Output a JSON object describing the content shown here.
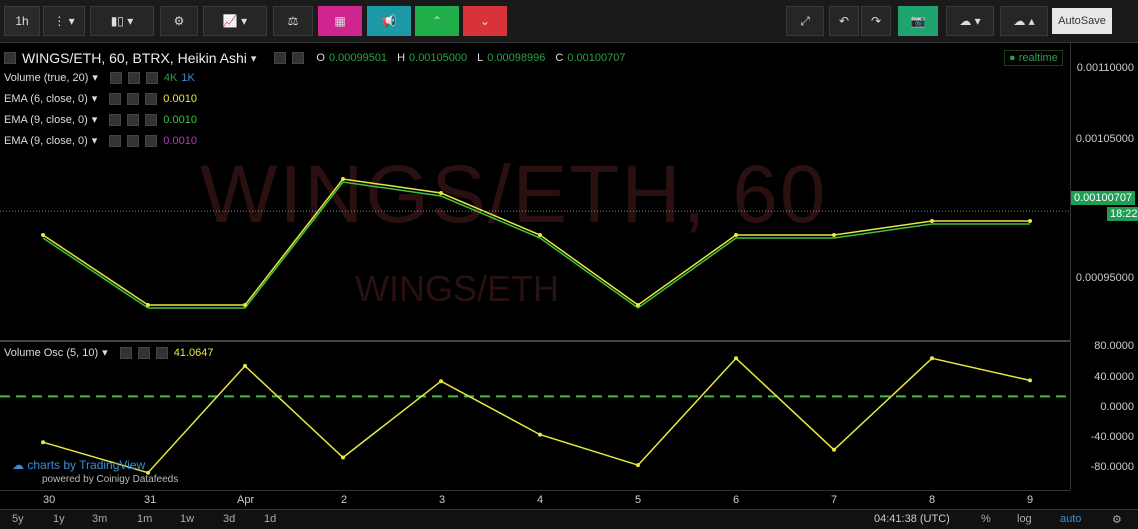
{
  "toolbar": {
    "interval": "1h",
    "autosave_label": "AutoSave",
    "colors": {
      "teal": "#1b9aa5",
      "green": "#1fae49",
      "red": "#d9333a"
    }
  },
  "symbol": {
    "title": "WINGS/ETH, 60, BTRX, Heikin Ashi",
    "watermark": "WINGS/ETH, 60",
    "watermark_sub": "WINGS/ETH",
    "o_label": "O",
    "o_value": "0.00099501",
    "h_label": "H",
    "h_value": "0.00105000",
    "l_label": "L",
    "l_value": "0.00098996",
    "c_label": "C",
    "c_value": "0.00100707",
    "realtime": "realtime"
  },
  "indicators": {
    "volume": {
      "label": "Volume (true, 20)",
      "v1": "4K",
      "v2": "1K"
    },
    "ema1": {
      "label": "EMA (6, close, 0)",
      "value": "0.0010",
      "color": "#e8e840"
    },
    "ema2": {
      "label": "EMA (9, close, 0)",
      "value": "0.0010",
      "color": "#3cc43c"
    },
    "ema3": {
      "label": "EMA (9, close, 0)",
      "value": "0.0010",
      "color": "#c030c0"
    },
    "vosc": {
      "label": "Volume Osc (5, 10)",
      "value": "41.0647"
    }
  },
  "price_scale": {
    "ticks": [
      "0.00110000",
      "0.00105000",
      "0.00095000"
    ],
    "current": "0.00100707",
    "countdown": "18:22"
  },
  "osc_scale": {
    "ticks": [
      "80.0000",
      "40.0000",
      "0.0000",
      "-40.0000",
      "-80.0000"
    ]
  },
  "xaxis": {
    "ticks": [
      "30",
      "31",
      "Apr",
      "2",
      "3",
      "4",
      "5",
      "6",
      "7",
      "8",
      "9"
    ]
  },
  "branding": {
    "line1": "charts by TradingView",
    "line2": "powered by Coinigy Datafeeds"
  },
  "bottom": {
    "ranges": [
      "5y",
      "1y",
      "3m",
      "1m",
      "1w",
      "3d",
      "1d"
    ],
    "time": "04:41:38 (UTC)",
    "pct": "%",
    "log": "log",
    "auto": "auto"
  },
  "chart_data": {
    "type": "line",
    "title": "WINGS/ETH, 60, BTRX, Heikin Ashi",
    "x": [
      "30",
      "31",
      "Apr",
      "2",
      "3",
      "4",
      "5",
      "6",
      "7",
      "8",
      "9"
    ],
    "series": [
      {
        "name": "EMA (6, close, 0)",
        "values": [
          0.00099,
          0.00094,
          0.00094,
          0.00103,
          0.00102,
          0.00099,
          0.00094,
          0.00099,
          0.00099,
          0.001,
          0.001
        ]
      }
    ],
    "ylim": [
      0.00092,
      0.00112
    ],
    "oscillator": {
      "name": "Volume Osc (5, 10)",
      "values": [
        -40,
        -80,
        60,
        -60,
        40,
        -30,
        -70,
        70,
        -50,
        70,
        41
      ],
      "ylim": [
        -100,
        90
      ]
    }
  }
}
